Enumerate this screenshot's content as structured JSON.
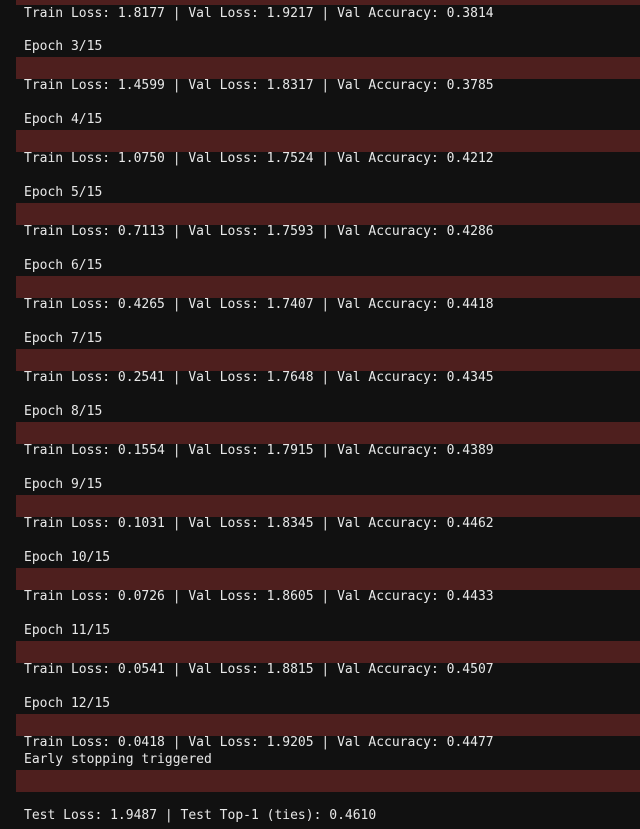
{
  "log": {
    "first_metrics": "Train Loss: 1.8177 | Val Loss: 1.9217 | Val Accuracy: 0.3814",
    "epochs": [
      {
        "epoch": "Epoch 3/15",
        "metrics": "Train Loss: 1.4599 | Val Loss: 1.8317 | Val Accuracy: 0.3785"
      },
      {
        "epoch": "Epoch 4/15",
        "metrics": "Train Loss: 1.0750 | Val Loss: 1.7524 | Val Accuracy: 0.4212"
      },
      {
        "epoch": "Epoch 5/15",
        "metrics": "Train Loss: 0.7113 | Val Loss: 1.7593 | Val Accuracy: 0.4286"
      },
      {
        "epoch": "Epoch 6/15",
        "metrics": "Train Loss: 0.4265 | Val Loss: 1.7407 | Val Accuracy: 0.4418"
      },
      {
        "epoch": "Epoch 7/15",
        "metrics": "Train Loss: 0.2541 | Val Loss: 1.7648 | Val Accuracy: 0.4345"
      },
      {
        "epoch": "Epoch 8/15",
        "metrics": "Train Loss: 0.1554 | Val Loss: 1.7915 | Val Accuracy: 0.4389"
      },
      {
        "epoch": "Epoch 9/15",
        "metrics": "Train Loss: 0.1031 | Val Loss: 1.8345 | Val Accuracy: 0.4462"
      },
      {
        "epoch": "Epoch 10/15",
        "metrics": "Train Loss: 0.0726 | Val Loss: 1.8605 | Val Accuracy: 0.4433"
      },
      {
        "epoch": "Epoch 11/15",
        "metrics": "Train Loss: 0.0541 | Val Loss: 1.8815 | Val Accuracy: 0.4507"
      },
      {
        "epoch": "Epoch 12/15",
        "metrics": "Train Loss: 0.0418 | Val Loss: 1.9205 | Val Accuracy: 0.4477"
      }
    ],
    "early_stop": "Early stopping triggered",
    "test_result": "Test Loss: 1.9487 | Test Top-1 (ties): 0.4610"
  },
  "colors": {
    "background": "#111111",
    "progress_bar": "#4e1f1e",
    "text": "#e8e8e8"
  }
}
